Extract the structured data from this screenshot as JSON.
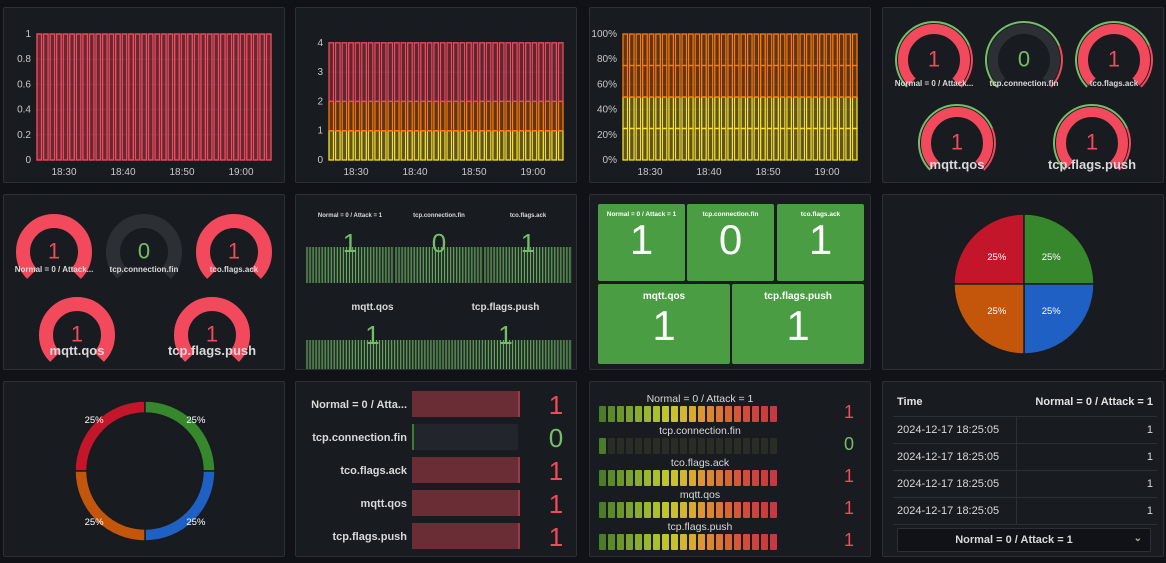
{
  "colors": {
    "red": "#f2495c",
    "green": "#73bf69",
    "yellow": "#fade2a",
    "orange": "#ff780a",
    "blue": "#3d8bff",
    "darkorange": "#c4560c"
  },
  "chart_data": [
    {
      "type": "bar",
      "x_ticks": [
        "18:30",
        "18:40",
        "18:50",
        "19:00"
      ],
      "y_ticks": [
        "0",
        "0.2",
        "0.4",
        "0.6",
        "0.8",
        "1"
      ],
      "ylim": [
        0,
        1
      ],
      "bar_count": 36,
      "values": [
        1
      ],
      "series": [
        {
          "color": "#f2495c"
        }
      ]
    },
    {
      "type": "bar",
      "stacked": true,
      "x_ticks": [
        "18:30",
        "18:40",
        "18:50",
        "19:00"
      ],
      "y_ticks": [
        "0",
        "1",
        "2",
        "3",
        "4"
      ],
      "ylim": [
        0,
        4.3
      ],
      "bar_count": 36,
      "series": [
        {
          "color": "#fade2a",
          "value": 1
        },
        {
          "color": "#ff780a",
          "value": 1
        },
        {
          "color": "#f2495c",
          "value": 2
        }
      ]
    },
    {
      "type": "bar",
      "stacked": true,
      "percent": true,
      "x_ticks": [
        "18:30",
        "18:40",
        "18:50",
        "19:00"
      ],
      "y_ticks": [
        "0%",
        "20%",
        "40%",
        "60%",
        "80%",
        "100%"
      ],
      "ylim": [
        0,
        100
      ],
      "bar_count": 36,
      "series": [
        {
          "color": "#fade2a",
          "value": 25
        },
        {
          "color": "#fade2a",
          "value": 25
        },
        {
          "color": "#ff780a",
          "value": 25
        },
        {
          "color": "#ff780a",
          "value": 25
        }
      ]
    },
    {
      "type": "pie",
      "categories": [
        "",
        "",
        "",
        ""
      ],
      "values": [
        25,
        25,
        25,
        25
      ],
      "labels": [
        "25%",
        "25%",
        "25%",
        "25%"
      ],
      "colors": [
        "#c4162a",
        "#37872d",
        "#1f60c4",
        "#c4560c"
      ]
    },
    {
      "type": "pie",
      "donut": true,
      "categories": [
        "",
        "",
        "",
        ""
      ],
      "values": [
        25,
        25,
        25,
        25
      ],
      "labels": [
        "25%",
        "25%",
        "25%",
        "25%"
      ],
      "colors": [
        "#c4162a",
        "#37872d",
        "#1f60c4",
        "#c4560c"
      ]
    }
  ],
  "metrics": [
    {
      "name": "Normal = 0 / Attack = 1",
      "short": "Normal = 0 / Attac...",
      "gauge_short": "Normal = 0 / Attack...",
      "value": "1",
      "level": 1
    },
    {
      "name": "tcp.connection.fin",
      "value": "0",
      "level": 0
    },
    {
      "name": "tco.flags.ack",
      "value": "1",
      "level": 1
    },
    {
      "name": "mqtt.qos",
      "value": "1",
      "level": 1
    },
    {
      "name": "tcp.flags.push",
      "value": "1",
      "level": 1
    }
  ],
  "bargauge_short": "Normal = 0 / Atta...",
  "table": {
    "headers": [
      "Time",
      "Normal = 0 / Attack = 1"
    ],
    "rows": [
      [
        "2024-12-17 18:25:05",
        "1"
      ],
      [
        "2024-12-17 18:25:05",
        "1"
      ],
      [
        "2024-12-17 18:25:05",
        "1"
      ],
      [
        "2024-12-17 18:25:05",
        "1"
      ]
    ],
    "select_value": "Normal = 0 / Attack = 1",
    "select_icon": "chevron-down-icon"
  }
}
